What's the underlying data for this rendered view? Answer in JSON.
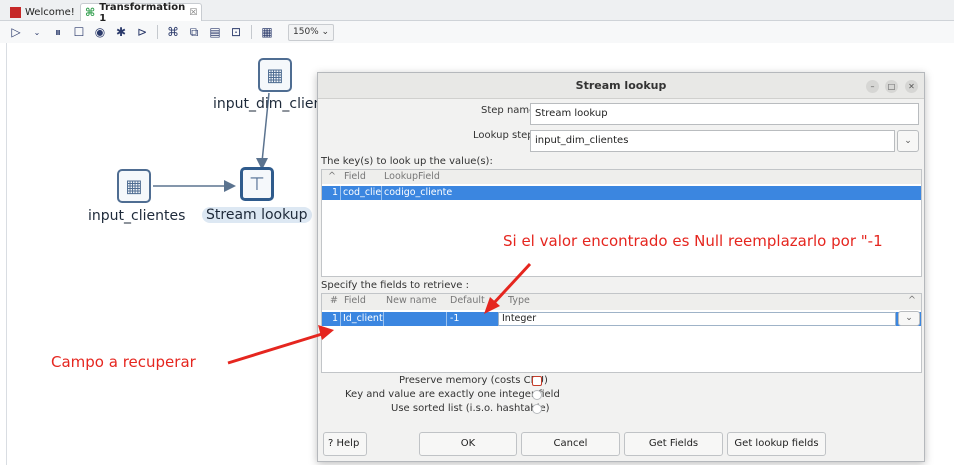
{
  "tabs": [
    {
      "label": "Welcome!",
      "active": false
    },
    {
      "label": "Transformation 1",
      "active": true,
      "close": "☒"
    }
  ],
  "toolbar": {
    "zoom": "150%",
    "icons": [
      "run-icon",
      "pause-icon",
      "stop-icon",
      "preview-icon",
      "debug-icon",
      "replay-icon",
      "verify-icon",
      "impact-icon",
      "sql-icon",
      "explore-db-icon",
      "show-results-icon"
    ]
  },
  "canvas": {
    "steps": [
      {
        "name": "input_dim_clientes",
        "label": "input_dim_clien"
      },
      {
        "name": "input_clientes",
        "label": "input_clientes"
      },
      {
        "name": "stream_lookup",
        "label": "Stream lookup"
      }
    ]
  },
  "dialog": {
    "title": "Stream lookup",
    "step_name_label": "Step name",
    "step_name_value": "Stream lookup",
    "lookup_step_label": "Lookup step",
    "lookup_step_value": "input_dim_clientes",
    "keys_section": "The key(s) to look up the value(s):",
    "keys_headers": [
      "Field",
      "LookupField"
    ],
    "keys_rows": [
      {
        "num": "1",
        "field": "cod_clie",
        "lookup_field": "codigo_cliente"
      }
    ],
    "retrieve_section": "Specify the fields to retrieve :",
    "retrieve_headers": [
      "#",
      "Field",
      "New name",
      "Default",
      "Type"
    ],
    "retrieve_rows": [
      {
        "num": "1",
        "field": "Id_client",
        "new_name": "",
        "default": "-1",
        "type": "Integer"
      }
    ],
    "options": {
      "preserve_memory": "Preserve memory (costs CPU)",
      "key_value_integer": "Key and value are exactly one integer field",
      "sorted_list": "Use sorted list (i.s.o. hashtable)"
    },
    "buttons": {
      "help": "Help",
      "ok": "OK",
      "cancel": "Cancel",
      "get_fields": "Get Fields",
      "get_lookup_fields": "Get lookup fields"
    }
  },
  "annotations": {
    "null_note": "Si el valor encontrado es Null reemplazarlo por \"-1",
    "field_note": "Campo a recuperar",
    "color": "#e5261f"
  }
}
